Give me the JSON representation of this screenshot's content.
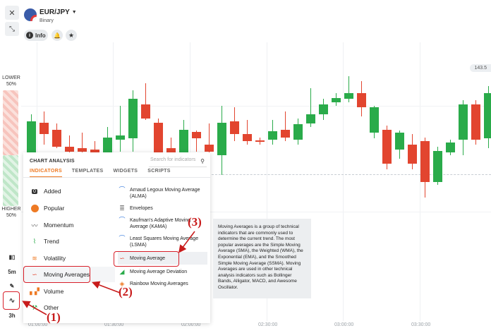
{
  "header": {
    "asset": "EUR/JPY",
    "asset_type": "Binary",
    "info_label": "Info"
  },
  "chart": {
    "price_badge": "143.5",
    "time_labels": [
      "01:00:00",
      "01:30:00",
      "02:00:00",
      "02:30:00",
      "03:00:00",
      "03:30:00"
    ]
  },
  "strip": {
    "lower_label": "LOWER",
    "lower_pct": "50%",
    "higher_label": "HIGHER",
    "higher_pct": "50%",
    "timeframe_1": "5m",
    "timeframe_2": "3h"
  },
  "panel": {
    "title": "CHART ANALYSIS",
    "search_placeholder": "Search for indicators",
    "tabs": [
      "INDICATORS",
      "TEMPLATES",
      "WIDGETS",
      "SCRIPTS"
    ],
    "categories": [
      {
        "label": "Added",
        "icon": "zero-badge-icon"
      },
      {
        "label": "Popular",
        "icon": "flame-icon"
      },
      {
        "label": "Momentum",
        "icon": "momentum-icon"
      },
      {
        "label": "Trend",
        "icon": "trend-icon"
      },
      {
        "label": "Volatility",
        "icon": "volatility-icon"
      },
      {
        "label": "Moving Averages",
        "icon": "moving-average-icon"
      },
      {
        "label": "Volume",
        "icon": "volume-icon"
      },
      {
        "label": "Other",
        "icon": "other-icon"
      }
    ],
    "indicators": [
      "Arnaud Legoux Moving Average (ALMA)",
      "Envelopes",
      "Kaufman's Adaptive Moving Average (KAMA)",
      "Least Squares Moving Average (LSMA)",
      "Moving Average",
      "Moving Average Deviation",
      "Rainbow Moving Averages"
    ]
  },
  "tooltip": {
    "text": "Moving Averages is a group of technical indicators that are commonly used to determine the current trend. The most popular averages are the Simple Moving Average (SMA), the Weighted (WMA), the Exponential (EMA), and the Smoothed Simple Moving Average (SSMA). Moving Averages are used in other technical analysis indicators such as Bollinger Bands, Alligator, MACD, and Awesome Oscillator."
  },
  "annotations": {
    "step1": "(1)",
    "step2": "(2)",
    "step3": "(3)"
  },
  "colors": {
    "up": "#2aab4a",
    "down": "#e2452f",
    "accent": "#ee7a24",
    "annotation": "#c81b1b"
  }
}
